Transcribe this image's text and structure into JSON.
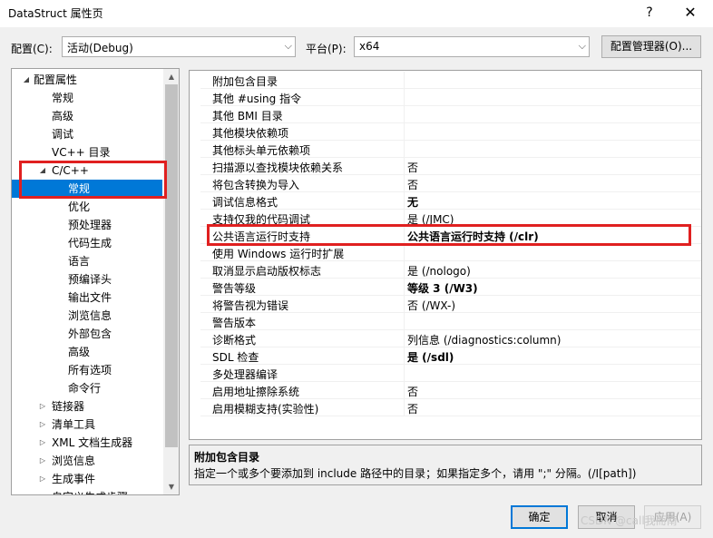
{
  "window": {
    "title": "DataStruct 属性页",
    "help_glyph": "?",
    "close_glyph": "✕"
  },
  "toolbar": {
    "config_label": "配置(C):",
    "config_value": "活动(Debug)",
    "platform_label": "平台(P):",
    "platform_value": "x64",
    "config_manager_label": "配置管理器(O)..."
  },
  "tree": {
    "items": [
      {
        "label": "配置属性",
        "arrow": "◢"
      },
      {
        "label": "常规"
      },
      {
        "label": "高级"
      },
      {
        "label": "调试"
      },
      {
        "label": "VC++ 目录"
      },
      {
        "label": "C/C++",
        "arrow": "◢"
      },
      {
        "label": "常规"
      },
      {
        "label": "优化"
      },
      {
        "label": "预处理器"
      },
      {
        "label": "代码生成"
      },
      {
        "label": "语言"
      },
      {
        "label": "预编译头"
      },
      {
        "label": "输出文件"
      },
      {
        "label": "浏览信息"
      },
      {
        "label": "外部包含"
      },
      {
        "label": "高级"
      },
      {
        "label": "所有选项"
      },
      {
        "label": "命令行"
      },
      {
        "label": "链接器",
        "arrow": "▷"
      },
      {
        "label": "清单工具",
        "arrow": "▷"
      },
      {
        "label": "XML 文档生成器",
        "arrow": "▷"
      },
      {
        "label": "浏览信息",
        "arrow": "▷"
      },
      {
        "label": "生成事件",
        "arrow": "▷"
      },
      {
        "label": "自定义生成步骤",
        "arrow": "▷"
      }
    ]
  },
  "properties": {
    "rows": [
      {
        "name": "附加包含目录",
        "value": ""
      },
      {
        "name": "其他 #using 指令",
        "value": ""
      },
      {
        "name": "其他 BMI 目录",
        "value": ""
      },
      {
        "name": "其他模块依赖项",
        "value": ""
      },
      {
        "name": "其他标头单元依赖项",
        "value": ""
      },
      {
        "name": "扫描源以查找模块依赖关系",
        "value": "否"
      },
      {
        "name": "将包含转换为导入",
        "value": "否"
      },
      {
        "name": "调试信息格式",
        "value": "无"
      },
      {
        "name": "支持仅我的代码调试",
        "value": "是 (/JMC)"
      },
      {
        "name": "公共语言运行时支持",
        "value": "公共语言运行时支持 (/clr)"
      },
      {
        "name": "使用 Windows 运行时扩展",
        "value": ""
      },
      {
        "name": "取消显示启动版权标志",
        "value": "是 (/nologo)"
      },
      {
        "name": "警告等级",
        "value": "等级 3 (/W3)"
      },
      {
        "name": "将警告视为错误",
        "value": "否 (/WX-)"
      },
      {
        "name": "警告版本",
        "value": ""
      },
      {
        "name": "诊断格式",
        "value": "列信息 (/diagnostics:column)"
      },
      {
        "name": "SDL 检查",
        "value": "是 (/sdl)"
      },
      {
        "name": "多处理器编译",
        "value": ""
      },
      {
        "name": "启用地址擦除系统",
        "value": "否"
      },
      {
        "name": "启用模糊支持(实验性)",
        "value": "否"
      }
    ]
  },
  "description": {
    "title": "附加包含目录",
    "text": "指定一个或多个要添加到 include 路径中的目录；如果指定多个，请用 \";\" 分隔。(/I[path])"
  },
  "footer": {
    "ok_label": "确定",
    "cancel_label": "取消",
    "apply_label": "应用(A)"
  },
  "watermark": "CSDN @call我而南",
  "colors": {
    "selection": "#0078d7",
    "highlight_box": "#e02020"
  }
}
